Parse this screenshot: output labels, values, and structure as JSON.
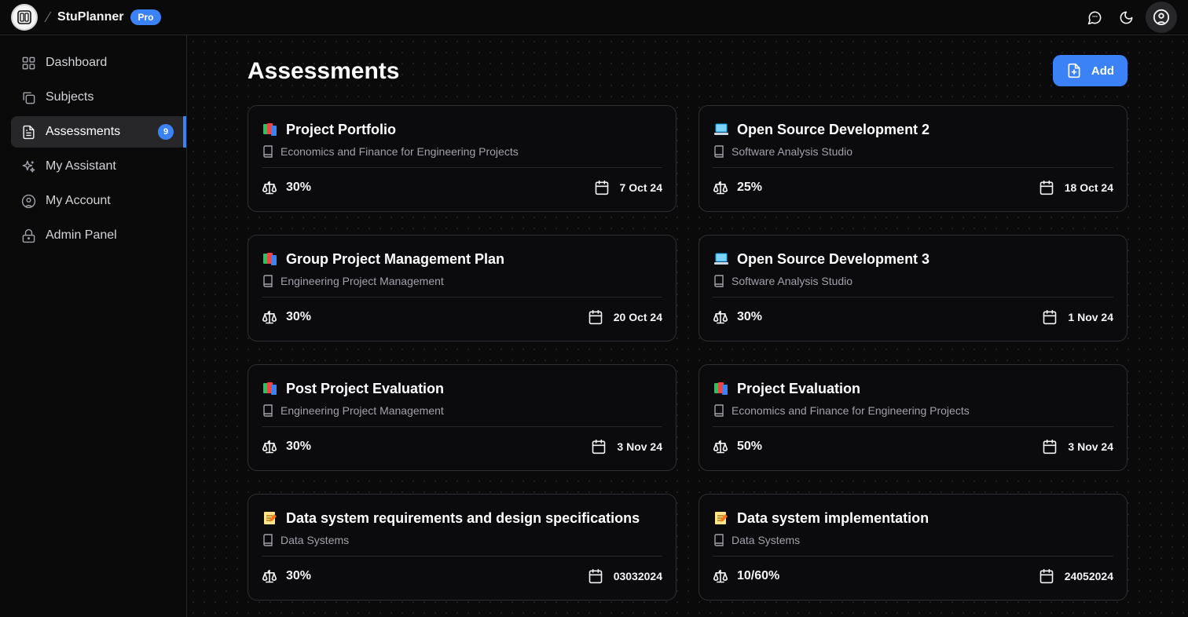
{
  "app": {
    "brand": "StuPlanner",
    "plan_badge": "Pro"
  },
  "sidebar": {
    "items": [
      {
        "label": "Dashboard",
        "icon": "grid-icon"
      },
      {
        "label": "Subjects",
        "icon": "copy-icon"
      },
      {
        "label": "Assessments",
        "icon": "file-text-icon",
        "badge": "9",
        "active": true
      },
      {
        "label": "My Assistant",
        "icon": "sparkles-icon"
      },
      {
        "label": "My Account",
        "icon": "user-circle-icon"
      },
      {
        "label": "Admin Panel",
        "icon": "lock-icon"
      }
    ]
  },
  "main": {
    "title": "Assessments",
    "add_label": "Add",
    "accent": "#3b82f6",
    "assessments": [
      {
        "emoji": "books-icon",
        "title": "Project Portfolio",
        "subject": "Economics and Finance for Engineering Projects",
        "weight": "30%",
        "due": "7 Oct 24"
      },
      {
        "emoji": "laptop-icon",
        "title": "Open Source Development 2",
        "subject": "Software Analysis Studio",
        "weight": "25%",
        "due": "18 Oct 24"
      },
      {
        "emoji": "books-icon",
        "title": "Group Project Management Plan",
        "subject": "Engineering Project Management",
        "weight": "30%",
        "due": "20 Oct 24"
      },
      {
        "emoji": "laptop-icon",
        "title": "Open Source Development 3",
        "subject": "Software Analysis Studio",
        "weight": "30%",
        "due": "1 Nov 24"
      },
      {
        "emoji": "books-icon",
        "title": "Post Project Evaluation",
        "subject": "Engineering Project Management",
        "weight": "30%",
        "due": "3 Nov 24"
      },
      {
        "emoji": "books-icon",
        "title": "Project Evaluation",
        "subject": "Economics and Finance for Engineering Projects",
        "weight": "50%",
        "due": "3 Nov 24"
      },
      {
        "emoji": "memo-icon",
        "title": "Data system requirements and design specifications",
        "subject": "Data Systems",
        "weight": "30%",
        "due": "03032024"
      },
      {
        "emoji": "memo-icon",
        "title": "Data system implementation",
        "subject": "Data Systems",
        "weight": "10/60%",
        "due": "24052024"
      }
    ]
  }
}
